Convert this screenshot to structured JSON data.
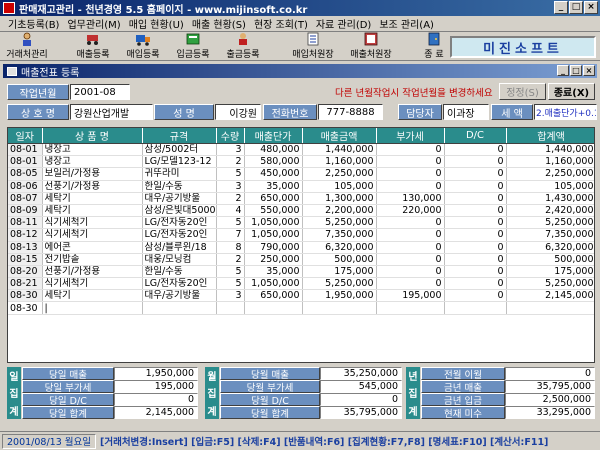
{
  "window": {
    "title": "판매재고관리 - 천년경영 5.5  홈페이지 - www.mijinsoft.co.kr",
    "min": "_",
    "max": "□",
    "close": "×"
  },
  "menu": [
    "기초등록(B)",
    "업무관리(M)",
    "매입 현황(U)",
    "매출 현황(S)",
    "현장 조회(T)",
    "자료 관리(D)",
    "보조 관리(A)"
  ],
  "toolbar": {
    "buttons": [
      {
        "label": "거래처관리",
        "icon": "person-icon"
      },
      {
        "label": "매출등록",
        "icon": "cart-icon"
      },
      {
        "label": "매입등록",
        "icon": "truck-icon"
      },
      {
        "label": "입금등록",
        "icon": "deposit-icon"
      },
      {
        "label": "출금등록",
        "icon": "withdraw-icon"
      },
      {
        "label": "매입처원장",
        "icon": "ledger-icon"
      },
      {
        "label": "매출처원장",
        "icon": "ledger2-icon"
      },
      {
        "label": "종 료",
        "icon": "exit-door-icon"
      }
    ],
    "brand": "미진소프트"
  },
  "doc": {
    "title": "매출전표 등록"
  },
  "form": {
    "period_label": "작업년월",
    "period_value": "2001-08",
    "notice": "다른 년월작업시 작업년월을 변경하세요",
    "correct_label": "정정(S)",
    "close_label": "종료(X)",
    "company_label": "상 호 명",
    "company_value": "강원산업개발",
    "name_label": "성  명",
    "name_value": "이강원",
    "phone_label": "전화번호",
    "phone_value": "777-8888",
    "manager_label": "담당자",
    "manager_value": "이과장",
    "tax_label": "세  액",
    "tax_value": "2.매출단가+0.1"
  },
  "grid": {
    "columns": [
      "일자",
      "상 품 명",
      "규격",
      "수량",
      "매출단가",
      "매출금액",
      "부가세",
      "D/C",
      "합계액"
    ],
    "rows": [
      [
        "08-01",
        "냉장고",
        "삼성/5002터",
        "3",
        "480,000",
        "1,440,000",
        "0",
        "0",
        "1,440,000"
      ],
      [
        "08-01",
        "냉장고",
        "LG/모델123-12",
        "2",
        "580,000",
        "1,160,000",
        "0",
        "0",
        "1,160,000"
      ],
      [
        "08-05",
        "보일러/가정용",
        "귀뚜라미",
        "5",
        "450,000",
        "2,250,000",
        "0",
        "0",
        "2,250,000"
      ],
      [
        "08-06",
        "선풍기/가정용",
        "한일/수동",
        "3",
        "35,000",
        "105,000",
        "0",
        "0",
        "105,000"
      ],
      [
        "08-07",
        "세탁기",
        "대우/공기방울",
        "2",
        "650,000",
        "1,300,000",
        "130,000",
        "0",
        "1,430,000"
      ],
      [
        "08-09",
        "세탁기",
        "삼성/은빛대5000",
        "4",
        "550,000",
        "2,200,000",
        "220,000",
        "0",
        "2,420,000"
      ],
      [
        "08-11",
        "식기세척기",
        "LG/전자동20인",
        "5",
        "1,050,000",
        "5,250,000",
        "0",
        "0",
        "5,250,000"
      ],
      [
        "08-12",
        "식기세척기",
        "LG/전자동20인",
        "7",
        "1,050,000",
        "7,350,000",
        "0",
        "0",
        "7,350,000"
      ],
      [
        "08-13",
        "에어콘",
        "삼성/블루윈/18",
        "8",
        "790,000",
        "6,320,000",
        "0",
        "0",
        "6,320,000"
      ],
      [
        "08-15",
        "전기밥솥",
        "대웅/모닝컴",
        "2",
        "250,000",
        "500,000",
        "0",
        "0",
        "500,000"
      ],
      [
        "08-20",
        "선풍기/가정용",
        "한일/수동",
        "5",
        "35,000",
        "175,000",
        "0",
        "0",
        "175,000"
      ],
      [
        "08-21",
        "식기세척기",
        "LG/전자동20인",
        "5",
        "1,050,000",
        "5,250,000",
        "0",
        "0",
        "5,250,000"
      ],
      [
        "08-30",
        "세탁기",
        "대우/공기방울",
        "3",
        "650,000",
        "1,950,000",
        "195,000",
        "0",
        "2,145,000"
      ],
      [
        "08-30",
        "|",
        "",
        "",
        "",
        "",
        "",
        "",
        ""
      ]
    ]
  },
  "summary": {
    "daily": {
      "side": [
        "일",
        "집",
        "계"
      ],
      "items": [
        {
          "label": "당일 매출",
          "value": "1,950,000"
        },
        {
          "label": "당일 부가세",
          "value": "195,000"
        },
        {
          "label": "당일 D/C",
          "value": "0"
        },
        {
          "label": "당일 합계",
          "value": "2,145,000"
        }
      ]
    },
    "monthly": {
      "side": [
        "월",
        "집",
        "계"
      ],
      "items": [
        {
          "label": "당월 매출",
          "value": "35,250,000"
        },
        {
          "label": "당월 부가세",
          "value": "545,000"
        },
        {
          "label": "당월 D/C",
          "value": "0"
        },
        {
          "label": "당월 합계",
          "value": "35,795,000"
        }
      ]
    },
    "yearly": {
      "side": [
        "년",
        "집",
        "계"
      ],
      "items": [
        {
          "label": "전월 이월",
          "value": "0"
        },
        {
          "label": "금년 매출",
          "value": "35,795,000"
        },
        {
          "label": "금년 입금",
          "value": "2,500,000"
        },
        {
          "label": "현재 미수",
          "value": "33,295,000"
        }
      ]
    }
  },
  "status": {
    "date": "2001/08/13 월요일",
    "keys": "[거래처변경:Insert] [입금:F5] [삭제:F4] [반품내역:F6] [집계현황:F7,F8] [명세표:F10] [계산서:F11]"
  }
}
